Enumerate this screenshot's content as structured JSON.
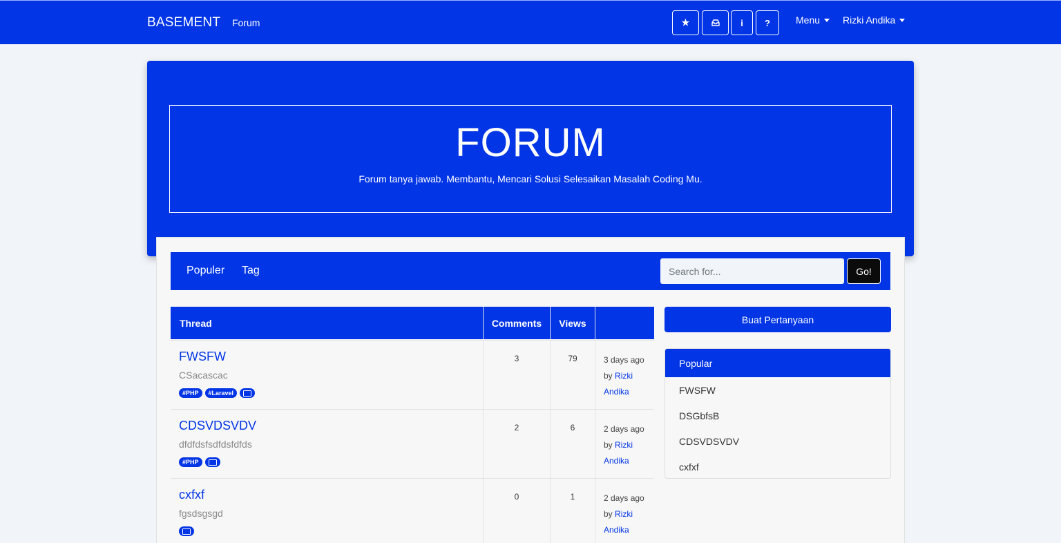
{
  "navbar": {
    "brand": "BASEMENT",
    "forum_link": "Forum",
    "icons": [
      "star-icon",
      "inbox-icon",
      "info-icon",
      "question-icon"
    ],
    "icon_glyphs": [
      "★",
      "⛁",
      "i",
      "?"
    ],
    "menu": "Menu",
    "user": "Rizki Andika"
  },
  "hero": {
    "title": "FORUM",
    "subtitle": "Forum tanya jawab. Membantu, Mencari Solusi Selesaikan Masalah Coding Mu."
  },
  "subnav": {
    "popular": "Populer",
    "tag": "Tag",
    "search_placeholder": "Search for...",
    "go": "Go!"
  },
  "table": {
    "headers": {
      "thread": "Thread",
      "comments": "Comments",
      "views": "Views",
      "info": ""
    },
    "rows": [
      {
        "title": "FWSFW",
        "desc": "CSacascac",
        "tags": [
          "#PHP",
          "#Laravel"
        ],
        "has_image": true,
        "comments": "3",
        "views": "79",
        "time": "3 days ago",
        "by": "by",
        "author_first": "Rizki",
        "author_last": "Andika"
      },
      {
        "title": "CDSVDSVDV",
        "desc": "dfdfdsfsdfdsfdfds",
        "tags": [
          "#PHP"
        ],
        "has_image": true,
        "comments": "2",
        "views": "6",
        "time": "2 days ago",
        "by": "by",
        "author_first": "Rizki",
        "author_last": "Andika"
      },
      {
        "title": "cxfxf",
        "desc": "fgsdsgsgd",
        "tags": [],
        "has_image": true,
        "comments": "0",
        "views": "1",
        "time": "2 days ago",
        "by": "by",
        "author_first": "Rizki",
        "author_last": "Andika"
      }
    ]
  },
  "sidebar": {
    "ask_button": "Buat Pertanyaan",
    "popular_header": "Popular",
    "popular_items": [
      "FWSFW",
      "DSGbfsB",
      "CDSVDSVDV",
      "cxfxf"
    ]
  },
  "colors": {
    "primary": "#0235e6",
    "background": "#f1f4f8",
    "go_button": "#0b0b0b"
  }
}
